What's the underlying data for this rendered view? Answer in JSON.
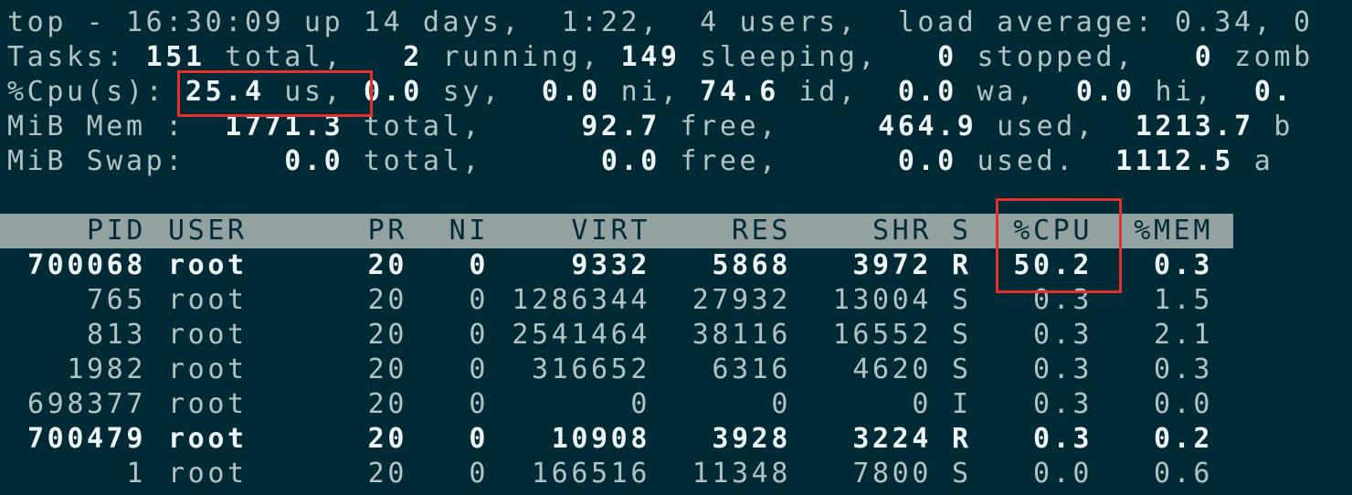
{
  "summary": {
    "uptime_line": "top - 16:30:09 up 14 days,  1:22,  4 users,  load average: 0.34, 0",
    "tasks": {
      "label": "Tasks: ",
      "total": "151",
      "total_label": " total,   ",
      "running": "2",
      "running_label": " running, ",
      "sleeping": "149",
      "sleeping_label": " sleeping,   ",
      "stopped": "0",
      "stopped_label": " stopped,   ",
      "zombie": "0",
      "zombie_label": " zomb"
    },
    "cpu": {
      "label": "%Cpu(s): ",
      "us": "25.4",
      "us_label": " us, ",
      "sy": "0.0",
      "sy_label": " sy,  ",
      "ni": "0.0",
      "ni_label": " ni, ",
      "id": "74.6",
      "id_label": " id,  ",
      "wa": "0.0",
      "wa_label": " wa,  ",
      "hi": "0.0",
      "hi_label": " hi,  ",
      "si": "0."
    },
    "mem": {
      "label": "MiB Mem :  ",
      "total": "1771.3",
      "total_label": " total,     ",
      "free": "92.7",
      "free_label": " free,     ",
      "used": "464.9",
      "used_label": " used,  ",
      "buff": "1213.7",
      "buff_label": " b"
    },
    "swap": {
      "label": "MiB Swap:     ",
      "total": "0.0",
      "total_label": " total,      ",
      "free": "0.0",
      "free_label": " free,      ",
      "used": "0.0",
      "used_label": " used.  ",
      "avail": "1112.5",
      "avail_label": " a"
    }
  },
  "table": {
    "headers": [
      "PID",
      "USER",
      "PR",
      "NI",
      "VIRT",
      "RES",
      "SHR",
      "S",
      "%CPU",
      "%MEM"
    ],
    "rows": [
      {
        "pid": "700068",
        "user": "root",
        "pr": "20",
        "ni": "0",
        "virt": "9332",
        "res": "5868",
        "shr": "3972",
        "s": "R",
        "cpu": "50.2",
        "mem": "0.3",
        "bold": true
      },
      {
        "pid": "765",
        "user": "root",
        "pr": "20",
        "ni": "0",
        "virt": "1286344",
        "res": "27932",
        "shr": "13004",
        "s": "S",
        "cpu": "0.3",
        "mem": "1.5",
        "bold": false
      },
      {
        "pid": "813",
        "user": "root",
        "pr": "20",
        "ni": "0",
        "virt": "2541464",
        "res": "38116",
        "shr": "16552",
        "s": "S",
        "cpu": "0.3",
        "mem": "2.1",
        "bold": false
      },
      {
        "pid": "1982",
        "user": "root",
        "pr": "20",
        "ni": "0",
        "virt": "316652",
        "res": "6316",
        "shr": "4620",
        "s": "S",
        "cpu": "0.3",
        "mem": "0.3",
        "bold": false
      },
      {
        "pid": "698377",
        "user": "root",
        "pr": "20",
        "ni": "0",
        "virt": "0",
        "res": "0",
        "shr": "0",
        "s": "I",
        "cpu": "0.3",
        "mem": "0.0",
        "bold": false
      },
      {
        "pid": "700479",
        "user": "root",
        "pr": "20",
        "ni": "0",
        "virt": "10908",
        "res": "3928",
        "shr": "3224",
        "s": "R",
        "cpu": "0.3",
        "mem": "0.2",
        "bold": true
      },
      {
        "pid": "1",
        "user": "root",
        "pr": "20",
        "ni": "0",
        "virt": "166516",
        "res": "11348",
        "shr": "7800",
        "s": "S",
        "cpu": "0.0",
        "mem": "0.6",
        "bold": false
      }
    ]
  },
  "colors": {
    "background": "#002b36",
    "text": "#b3c2c4",
    "bold_text": "#eef3f3",
    "header_bar": "#93a1a1",
    "highlight_box": "#e8302a"
  }
}
